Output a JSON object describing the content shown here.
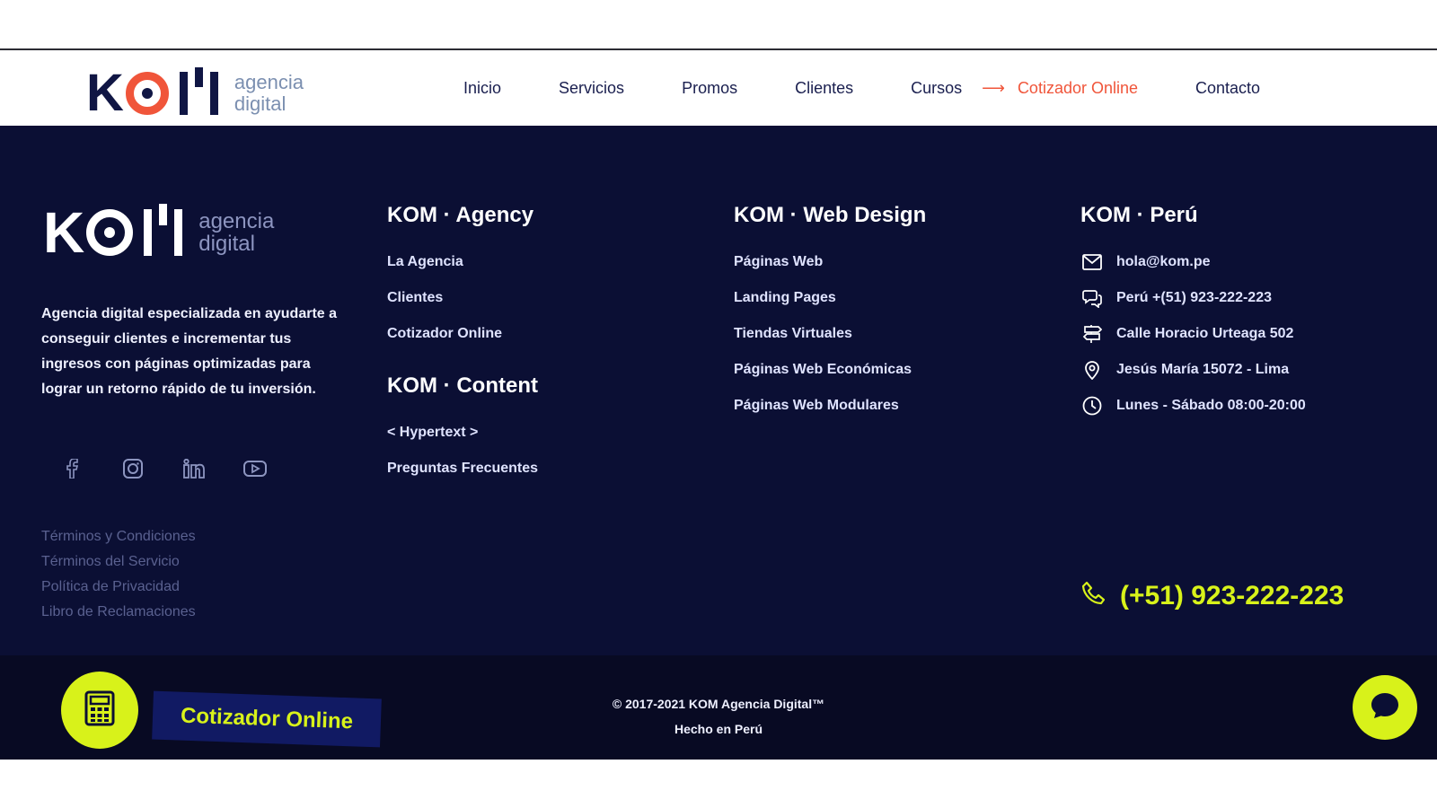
{
  "header": {
    "logo": {
      "mark": "KOM",
      "text_line1": "agencia",
      "text_line2": "digital"
    },
    "nav": [
      {
        "label": "Inicio"
      },
      {
        "label": "Servicios"
      },
      {
        "label": "Promos"
      },
      {
        "label": "Clientes"
      },
      {
        "label": "Cursos"
      },
      {
        "label": "Cotizador Online"
      },
      {
        "label": "Contacto"
      }
    ],
    "arrow": "⟶",
    "colors": {
      "accent": "#f0553a",
      "navy": "#101644"
    }
  },
  "footer": {
    "logo": {
      "mark": "KOM",
      "text_line1": "agencia",
      "text_line2": "digital"
    },
    "about": "Agencia digital especializada en ayudarte a conseguir clientes e incrementar tus ingresos con páginas optimizadas para lograr un retorno rápido de tu inversión.",
    "socials": [
      "facebook-icon",
      "instagram-icon",
      "linkedin-icon",
      "youtube-icon"
    ],
    "legal": [
      "Términos y Condiciones",
      "Términos del Servicio",
      "Política de Privacidad",
      "Libro de Reclamaciones"
    ],
    "agency": {
      "title": "KOM · Agency",
      "links": [
        "La Agencia",
        "Clientes",
        "Cotizador Online"
      ]
    },
    "content": {
      "title": "KOM · Content",
      "links": [
        "< Hypertext >",
        "Preguntas Frecuentes"
      ]
    },
    "webdesign": {
      "title": "KOM · Web Design",
      "links": [
        "Páginas Web",
        "Landing Pages",
        "Tiendas Virtuales",
        "Páginas Web Económicas",
        "Páginas Web Modulares"
      ]
    },
    "peru": {
      "title": "KOM · Perú",
      "email": "hola@kom.pe",
      "phone": "Perú +(51) 923-222-223",
      "address": "Calle Horacio Urteaga 502",
      "district": "Jesús María 15072 - Lima",
      "hours": "Lunes - Sábado 08:00-20:00"
    },
    "big_phone": "(+51) 923-222-223",
    "colors": {
      "background": "#0b0f34",
      "lime": "#d8f21a"
    }
  },
  "bottombar": {
    "quote_label": "Cotizador Online",
    "copyright_line1": "© 2017-2021 KOM Agencia Digital™",
    "copyright_line2": "Hecho en Perú"
  }
}
